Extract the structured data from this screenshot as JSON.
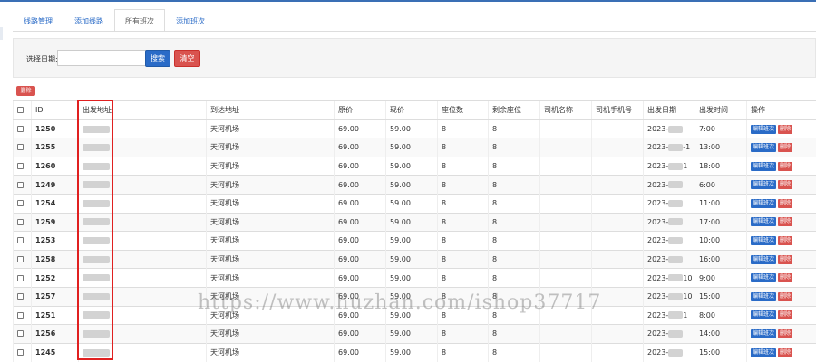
{
  "tabs": [
    {
      "label": "线路管理",
      "active": false
    },
    {
      "label": "添加线路",
      "active": false
    },
    {
      "label": "所有班次",
      "active": true
    },
    {
      "label": "添加班次",
      "active": false
    }
  ],
  "filter": {
    "label": "选择日期:",
    "value": "",
    "search_label": "搜索",
    "clear_label": "清空"
  },
  "batch_delete_label": "删除",
  "columns": [
    "",
    "ID",
    "出发地址",
    "到达地址",
    "原价",
    "现价",
    "座位数",
    "剩余座位",
    "司机名称",
    "司机手机号",
    "出发日期",
    "出发时间",
    "操作"
  ],
  "actions": {
    "edit": "编辑班次",
    "delete": "删除"
  },
  "rows": [
    {
      "id": "1250",
      "to": "天河机场",
      "orig": "69.00",
      "price": "59.00",
      "seats": "8",
      "left": "8",
      "driver": "",
      "phone": "",
      "date": "2023-",
      "date_tail": "",
      "time": "7:00"
    },
    {
      "id": "1255",
      "to": "天河机场",
      "orig": "69.00",
      "price": "59.00",
      "seats": "8",
      "left": "8",
      "driver": "",
      "phone": "",
      "date": "2023-",
      "date_tail": "-1",
      "time": "13:00"
    },
    {
      "id": "1260",
      "to": "天河机场",
      "orig": "69.00",
      "price": "59.00",
      "seats": "8",
      "left": "8",
      "driver": "",
      "phone": "",
      "date": "2023-",
      "date_tail": "1",
      "time": "18:00"
    },
    {
      "id": "1249",
      "to": "天河机场",
      "orig": "69.00",
      "price": "59.00",
      "seats": "8",
      "left": "8",
      "driver": "",
      "phone": "",
      "date": "2023-",
      "date_tail": "",
      "time": "6:00"
    },
    {
      "id": "1254",
      "to": "天河机场",
      "orig": "69.00",
      "price": "59.00",
      "seats": "8",
      "left": "8",
      "driver": "",
      "phone": "",
      "date": "2023-",
      "date_tail": "",
      "time": "11:00"
    },
    {
      "id": "1259",
      "to": "天河机场",
      "orig": "69.00",
      "price": "59.00",
      "seats": "8",
      "left": "8",
      "driver": "",
      "phone": "",
      "date": "2023-",
      "date_tail": "",
      "time": "17:00"
    },
    {
      "id": "1253",
      "to": "天河机场",
      "orig": "69.00",
      "price": "59.00",
      "seats": "8",
      "left": "8",
      "driver": "",
      "phone": "",
      "date": "2023-",
      "date_tail": "",
      "time": "10:00"
    },
    {
      "id": "1258",
      "to": "天河机场",
      "orig": "69.00",
      "price": "59.00",
      "seats": "8",
      "left": "8",
      "driver": "",
      "phone": "",
      "date": "2023-",
      "date_tail": "",
      "time": "16:00"
    },
    {
      "id": "1252",
      "to": "天河机场",
      "orig": "69.00",
      "price": "59.00",
      "seats": "8",
      "left": "8",
      "driver": "",
      "phone": "",
      "date": "2023-",
      "date_tail": "10",
      "time": "9:00"
    },
    {
      "id": "1257",
      "to": "天河机场",
      "orig": "69.00",
      "price": "59.00",
      "seats": "8",
      "left": "8",
      "driver": "",
      "phone": "",
      "date": "2023-",
      "date_tail": "10",
      "time": "15:00"
    },
    {
      "id": "1251",
      "to": "天河机场",
      "orig": "69.00",
      "price": "59.00",
      "seats": "8",
      "left": "8",
      "driver": "",
      "phone": "",
      "date": "2023-",
      "date_tail": "1",
      "time": "8:00"
    },
    {
      "id": "1256",
      "to": "天河机场",
      "orig": "69.00",
      "price": "59.00",
      "seats": "8",
      "left": "8",
      "driver": "",
      "phone": "",
      "date": "2023-",
      "date_tail": "",
      "time": "14:00"
    },
    {
      "id": "1245",
      "to": "天河机场",
      "orig": "69.00",
      "price": "59.00",
      "seats": "8",
      "left": "8",
      "driver": "",
      "phone": "",
      "date": "2023-",
      "date_tail": "",
      "time": "15:00"
    }
  ],
  "watermark": "https://www.huzhan.com/ishop37717",
  "colors": {
    "primary": "#2a6bc7",
    "danger": "#d9534f",
    "highlight": "#e02020"
  }
}
